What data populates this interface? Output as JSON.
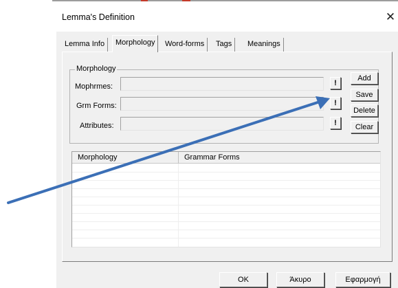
{
  "dialog": {
    "title": "Lemma's Definition",
    "close_glyph": "✕"
  },
  "tabs": [
    {
      "label": "Lemma Info",
      "active": false
    },
    {
      "label": "Morphology",
      "active": true
    },
    {
      "label": "Word-forms",
      "active": false
    },
    {
      "label": "Tags",
      "active": false
    },
    {
      "label": "Meanings",
      "active": false
    }
  ],
  "morphology_group": {
    "title": "Morphology",
    "fields": [
      {
        "label": "Mophrmes:",
        "value": "",
        "button": "!"
      },
      {
        "label": "Grm Forms:",
        "value": "",
        "button": "!"
      },
      {
        "label": "Attributes:",
        "value": "",
        "button": "!"
      }
    ]
  },
  "side_buttons": [
    "Add",
    "Save",
    "Delete",
    "Clear"
  ],
  "list": {
    "columns": [
      "Morphology",
      "Grammar Forms"
    ],
    "rows": []
  },
  "footer_buttons": [
    "OK",
    "Άκυρο",
    "Εφαρμογή"
  ],
  "colors": {
    "window_bg": "#f0f0f0",
    "annotation_arrow": "#3b6fb6",
    "top_marks": "#c43a2a"
  },
  "icons": [
    "close-icon",
    "annotation-arrow"
  ]
}
